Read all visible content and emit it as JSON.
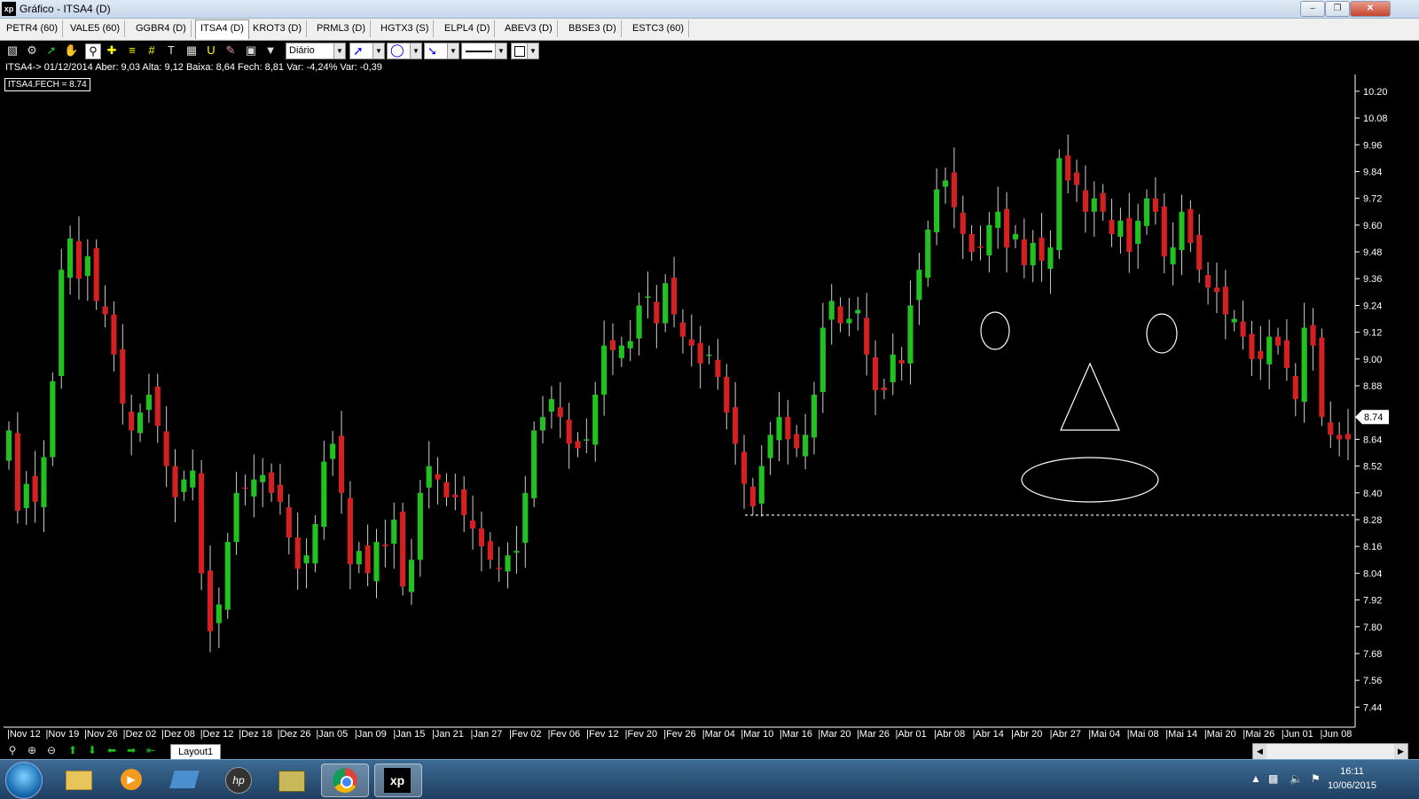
{
  "window": {
    "title": "Gráfico - ITSA4 (D)",
    "logo": "xp",
    "buttons": [
      "minimize-icon",
      "restore-icon",
      "close-icon"
    ]
  },
  "tabs": [
    {
      "label": "PETR4 (60)",
      "active": false
    },
    {
      "label": "VALE5 (60)",
      "active": false
    },
    {
      "label": "GGBR4 (D)",
      "active": false
    },
    {
      "label": "ITSA4 (D)",
      "active": true
    },
    {
      "label": "KROT3 (D)",
      "active": false
    },
    {
      "label": "PRML3 (D)",
      "active": false
    },
    {
      "label": "HGTX3 (S)",
      "active": false
    },
    {
      "label": "ELPL4 (D)",
      "active": false
    },
    {
      "label": "ABEV3 (D)",
      "active": false
    },
    {
      "label": "BBSE3 (D)",
      "active": false
    },
    {
      "label": "ESTC3 (60)",
      "active": false
    }
  ],
  "toolbar": {
    "icons": [
      "chart-type-icon",
      "settings-icon",
      "indicator-icon",
      "hand-icon",
      "zoom-icon",
      "crosshair-icon",
      "fibonacci-icon",
      "grid-icon",
      "text-icon",
      "calculator-icon",
      "magnet-icon",
      "eraser-icon",
      "lock-icon",
      "filter-icon"
    ],
    "period": "Diário",
    "line_tool": "trendline-icon",
    "shape_tool": "ellipse-icon",
    "fan_tool": "fan-icon",
    "line_style": "solid-line-icon",
    "color_tool": "color-box-icon"
  },
  "info_line": "ITSA4-> 01/12/2014 Aber: 9,03 Alta: 9,12 Baixa: 8,64 Fech: 8,81 Var: -4,24% Var: -0,39",
  "series_label": "ITSA4.FECH = 8.74",
  "chart_data": {
    "type": "candlestick",
    "symbol": "ITSA4",
    "timeframe": "D",
    "last_price": 8.74,
    "ylim": [
      7.36,
      10.26
    ],
    "y_ticks": [
      10.2,
      10.08,
      9.96,
      9.84,
      9.72,
      9.6,
      9.48,
      9.36,
      9.24,
      9.12,
      9.0,
      8.88,
      8.64,
      8.52,
      8.4,
      8.28,
      8.16,
      8.04,
      7.92,
      7.8,
      7.68,
      7.56,
      7.44
    ],
    "x_labels": [
      "Nov 12",
      "Nov 19",
      "Nov 26",
      "Dez 02",
      "Dez 08",
      "Dez 12",
      "Dez 18",
      "Dez 26",
      "Jan 05",
      "Jan 09",
      "Jan 15",
      "Jan 21",
      "Jan 27",
      "Fev 02",
      "Fev 06",
      "Fev 12",
      "Fev 20",
      "Fev 26",
      "Mar 04",
      "Mar 10",
      "Mar 16",
      "Mar 20",
      "Mar 26",
      "Abr 01",
      "Abr 08",
      "Abr 14",
      "Abr 20",
      "Abr 27",
      "Mai 04",
      "Mai 08",
      "Mai 14",
      "Mai 20",
      "Mai 26",
      "Jun 01",
      "Jun 08"
    ],
    "support_line": 8.3,
    "colors": {
      "up": "#22c122",
      "down": "#d42020",
      "background": "#000000",
      "axis": "#ffffff"
    },
    "closes": [
      8.68,
      8.32,
      8.44,
      8.36,
      8.56,
      8.9,
      9.4,
      9.54,
      9.36,
      9.46,
      9.26,
      9.2,
      9.02,
      8.8,
      8.68,
      8.76,
      8.84,
      8.7,
      8.52,
      8.38,
      8.46,
      8.5,
      8.04,
      7.78,
      7.9,
      8.18,
      8.4,
      8.42,
      8.46,
      8.48,
      8.4,
      8.36,
      8.2,
      8.06,
      8.12,
      8.26,
      8.54,
      8.62,
      8.4,
      8.08,
      8.14,
      8.04,
      8.18,
      8.16,
      8.28,
      7.98,
      8.1,
      8.4,
      8.52,
      8.46,
      8.38,
      8.38,
      8.3,
      8.24,
      8.16,
      8.1,
      8.06,
      8.12,
      8.14,
      8.4,
      8.68,
      8.74,
      8.82,
      8.74,
      8.62,
      8.6,
      8.64,
      8.84,
      9.06,
      9.04,
      9.06,
      9.08,
      9.24,
      9.28,
      9.16,
      9.34,
      9.2,
      9.1,
      9.06,
      8.98,
      9.02,
      8.92,
      8.76,
      8.62,
      8.44,
      8.34,
      8.52,
      8.66,
      8.74,
      8.64,
      8.6,
      8.66,
      8.84,
      9.14,
      9.26,
      9.16,
      9.18,
      9.22,
      9.02,
      8.86,
      8.86,
      9.02,
      8.98,
      9.24,
      9.4,
      9.58,
      9.76,
      9.8,
      9.68,
      9.56,
      9.48,
      9.5,
      9.6,
      9.66,
      9.5,
      9.56,
      9.42,
      9.52,
      9.44,
      9.5,
      9.9,
      9.8,
      9.78,
      9.66,
      9.72,
      9.66,
      9.56,
      9.62,
      9.48,
      9.62,
      9.72,
      9.66,
      9.46,
      9.5,
      9.66,
      9.52,
      9.4,
      9.32,
      9.3,
      9.2,
      9.18,
      9.1,
      9.0,
      9.0,
      9.1,
      9.06,
      8.96,
      8.82,
      9.14,
      9.06,
      8.74,
      8.66,
      8.64,
      8.64
    ]
  },
  "drawings": [
    {
      "name": "left-eye-ellipse",
      "shape": "ellipse"
    },
    {
      "name": "right-eye-ellipse",
      "shape": "ellipse"
    },
    {
      "name": "nose-triangle",
      "shape": "triangle"
    },
    {
      "name": "mouth-ellipse",
      "shape": "ellipse"
    }
  ],
  "bottom_nav": {
    "icons": [
      "zoom-icon",
      "zoom-in-icon",
      "zoom-out-icon",
      "arrow-up-icon",
      "arrow-down-icon",
      "arrow-left-icon",
      "arrow-right-icon",
      "arrow-back-icon"
    ],
    "layout_tab": "Layout1"
  },
  "taskbar": {
    "apps": [
      "start-orb",
      "explorer-icon",
      "media-player-icon",
      "remote-desktop-icon",
      "hp-icon",
      "file-transfer-icon",
      "chrome-icon",
      "xp-app-icon"
    ],
    "time": "16:11",
    "date": "10/06/2015"
  }
}
